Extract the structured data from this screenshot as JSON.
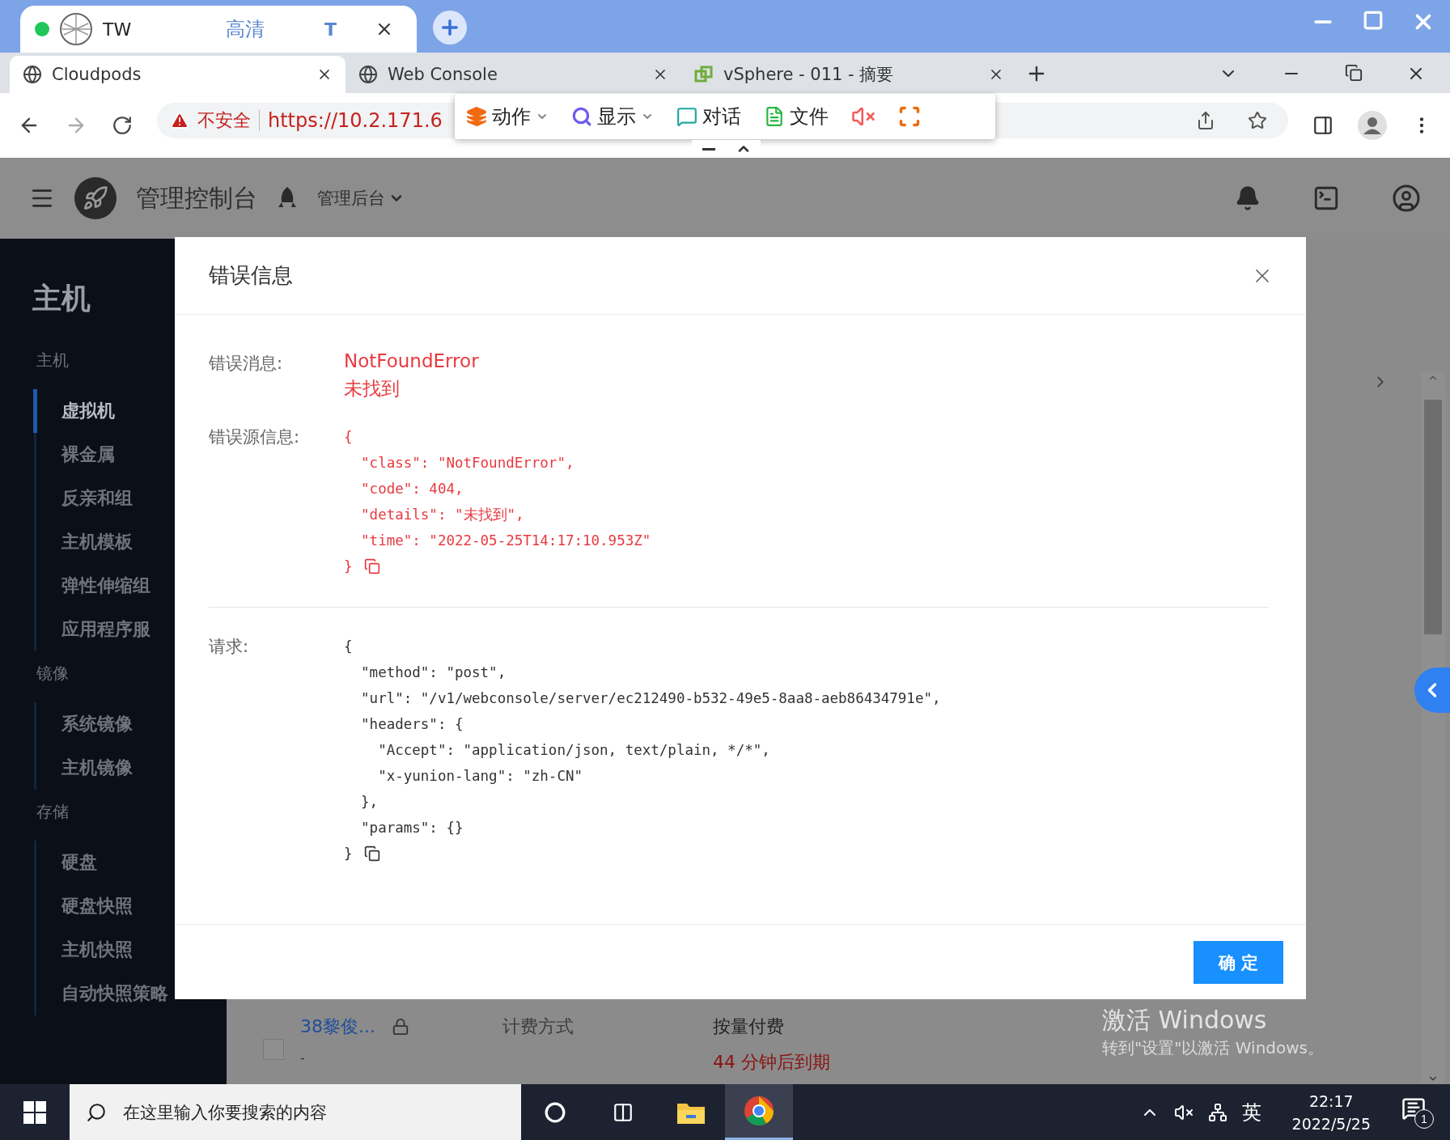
{
  "remote_window": {
    "title": "TW",
    "quality": "高清",
    "text_mode": "T"
  },
  "browser_tabs": [
    {
      "title": "Cloudpods",
      "selected": true,
      "kind": "globe"
    },
    {
      "title": "Web Console",
      "selected": false,
      "kind": "globe"
    },
    {
      "title": "vSphere - 011 - 摘要",
      "selected": false,
      "kind": "vsphere"
    }
  ],
  "address_bar": {
    "warning": "不安全",
    "url": "https://10.2.171.6"
  },
  "remote_toolbar": {
    "items": [
      {
        "label": "动作",
        "kind": "layers",
        "dropdown": true
      },
      {
        "label": "显示",
        "kind": "search",
        "dropdown": true
      },
      {
        "label": "对话",
        "kind": "chat",
        "dropdown": false
      },
      {
        "label": "文件",
        "kind": "file",
        "dropdown": false
      }
    ]
  },
  "app_header": {
    "title": "管理控制台",
    "scope": "管理后台"
  },
  "sidebar": {
    "title": "主机",
    "groups": [
      {
        "label": "主机",
        "items": [
          {
            "label": "虚拟机",
            "selected": true
          },
          {
            "label": "裸金属",
            "selected": false
          },
          {
            "label": "反亲和组",
            "selected": false
          },
          {
            "label": "主机模板",
            "selected": false
          },
          {
            "label": "弹性伸缩组",
            "selected": false
          },
          {
            "label": "应用程序服",
            "selected": false
          }
        ]
      },
      {
        "label": "镜像",
        "items": [
          {
            "label": "系统镜像",
            "selected": false
          },
          {
            "label": "主机镜像",
            "selected": false
          }
        ]
      },
      {
        "label": "存储",
        "items": [
          {
            "label": "硬盘",
            "selected": false
          },
          {
            "label": "硬盘快照",
            "selected": false
          },
          {
            "label": "主机快照",
            "selected": false
          },
          {
            "label": "自动快照策略",
            "selected": false
          }
        ]
      }
    ]
  },
  "background_row": {
    "checked": false,
    "name": "38黎俊...",
    "placeholder_value": "-",
    "billing_label": "计费方式",
    "billing": "按量付费",
    "expiry": "44 分钟后到期"
  },
  "modal": {
    "title": "错误信息",
    "fields": [
      {
        "label": "错误消息:",
        "kind": "message",
        "lines": [
          "NotFoundError",
          "未找到"
        ]
      },
      {
        "label": "错误源信息:",
        "kind": "code",
        "error": true,
        "lines": [
          "{",
          "  \"class\": \"NotFoundError\",",
          "  \"code\": 404,",
          "  \"details\": \"未找到\",",
          "  \"time\": \"2022-05-25T14:17:10.953Z\"",
          "}"
        ]
      },
      {
        "label": "请求:",
        "kind": "code",
        "error": false,
        "lines": [
          "{",
          "  \"method\": \"post\",",
          "  \"url\": \"/v1/webconsole/server/ec212490-b532-49e5-8aa8-aeb86434791e\",",
          "  \"headers\": {",
          "    \"Accept\": \"application/json, text/plain, */*\",",
          "    \"x-yunion-lang\": \"zh-CN\"",
          "  },",
          "  \"params\": {}",
          "}"
        ]
      }
    ],
    "ok_button": "确 定"
  },
  "activation_notice": {
    "title": "激活 Windows",
    "subtitle": "转到\"设置\"以激活 Windows。"
  },
  "taskbar": {
    "search_placeholder": "在这里输入你要搜索的内容",
    "ime": "英",
    "time": "22:17",
    "date": "2022/5/25",
    "notifications": "1"
  }
}
